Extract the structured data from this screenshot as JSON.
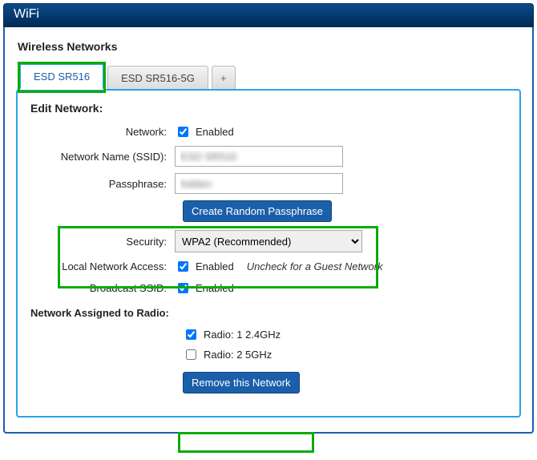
{
  "title": "WiFi",
  "section": "Wireless Networks",
  "tabs": {
    "active": "ESD SR516",
    "inactive": "ESD SR516-5G",
    "add": "+"
  },
  "panel": {
    "heading": "Edit Network:",
    "network_label": "Network:",
    "network_enabled_text": "Enabled",
    "ssid_label": "Network Name (SSID):",
    "ssid_value": "ESD SR516",
    "pass_label": "Passphrase:",
    "pass_value": "hidden",
    "random_btn": "Create Random Passphrase",
    "security_label": "Security:",
    "security_value": "WPA2 (Recommended)",
    "lan_label": "Local Network Access:",
    "lan_enabled_text": "Enabled",
    "lan_hint": "Uncheck for a Guest Network",
    "bcast_label": "Broadcast SSID:",
    "bcast_enabled_text": "Enabled",
    "radio_heading": "Network Assigned to Radio:",
    "radio1_label": "Radio:  1   2.4GHz",
    "radio2_label": "Radio:  2   5GHz",
    "remove_btn": "Remove this Network"
  }
}
